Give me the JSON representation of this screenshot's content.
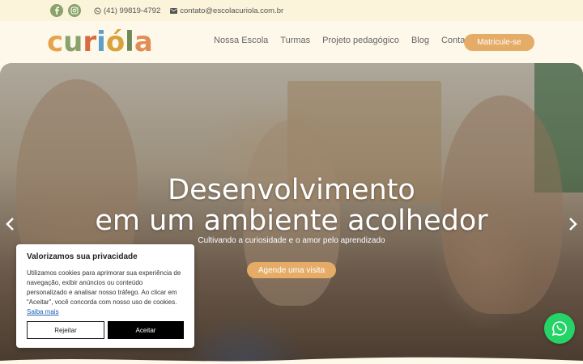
{
  "topbar": {
    "facebook_icon": "facebook-icon",
    "instagram_icon": "instagram-icon",
    "phone": "(41) 99819-4792",
    "email": "contato@escolacuriola.com.br"
  },
  "header": {
    "logo_letters": [
      "c",
      "u",
      "r",
      "i",
      "ó",
      "l",
      "a"
    ],
    "logo_colors": [
      "#e5a44c",
      "#8aa36a",
      "#d76b3f",
      "#5aa0c8",
      "#d9a23f",
      "#6f8a57",
      "#e28d55"
    ],
    "nav": [
      "Nossa Escola",
      "Turmas",
      "Projeto pedagógico",
      "Blog",
      "Contato"
    ],
    "cta": "Matricule-se"
  },
  "hero": {
    "title_line1": "Desenvolvimento",
    "title_line2": "em um ambiente acolhedor",
    "subtitle": "Cultivando a curiosidade e o amor pelo aprendizado",
    "button": "Agende uma visita"
  },
  "cookie": {
    "title": "Valorizamos sua privacidade",
    "text": "Utilizamos cookies para aprimorar sua experiência de navegação, exibir anúncios ou conteúdo personalizado e analisar nosso tráfego. Ao clicar em “Aceitar”, você concorda com nosso uso de cookies.",
    "link": "Saiba mais",
    "reject": "Rejeitar",
    "accept": "Aceitar"
  },
  "colors": {
    "accent": "#e5ac68",
    "green": "#8aa36a",
    "whatsapp": "#25d366"
  }
}
